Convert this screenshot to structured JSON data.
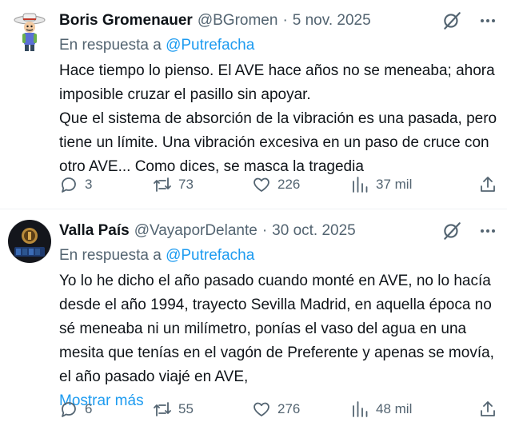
{
  "tweets": [
    {
      "name": "Boris Gromenauer",
      "handle": "@BGromen",
      "separator": "·",
      "date": "5 nov. 2025",
      "reply_prefix": "En respuesta a ",
      "reply_mention": "@Putrefacha",
      "body": "Hace tiempo lo pienso. El AVE hace años no se meneaba; ahora imposible cruzar el pasillo sin apoyar.\nQue el sistema de absorción de la vibración es una pasada, pero tiene un límite. Una vibración excesiva en un paso de cruce con otro AVE... Como dices, se masca la tragedia",
      "show_more": "",
      "replies": "3",
      "retweets": "73",
      "likes": "226",
      "views": "37 mil",
      "avatar_icon": "cartoon-character-avatar"
    },
    {
      "name": "Valla País",
      "handle": "@VayaporDelante",
      "separator": "·",
      "date": "30 oct. 2025",
      "reply_prefix": "En respuesta a ",
      "reply_mention": "@Putrefacha",
      "body": "Yo lo he dicho el año pasado cuando monté en AVE, no lo hacía desde el año 1994, trayecto Sevilla Madrid, en aquella época no sé meneaba ni un milímetro, ponías el vaso del agua en una mesita que tenías en el vagón de Preferente y apenas se movía, el año pasado viajé en AVE,",
      "show_more": "Mostrar más",
      "replies": "6",
      "retweets": "55",
      "likes": "276",
      "views": "48 mil",
      "avatar_icon": "dark-logo-avatar"
    }
  ],
  "colors": {
    "text": "#0f1419",
    "secondary": "#536471",
    "link": "#1d9bf0",
    "divider": "#eff3f4"
  },
  "icons": [
    "grok-icon",
    "more-icon",
    "reply-icon",
    "retweet-icon",
    "like-icon",
    "views-icon",
    "share-icon"
  ]
}
